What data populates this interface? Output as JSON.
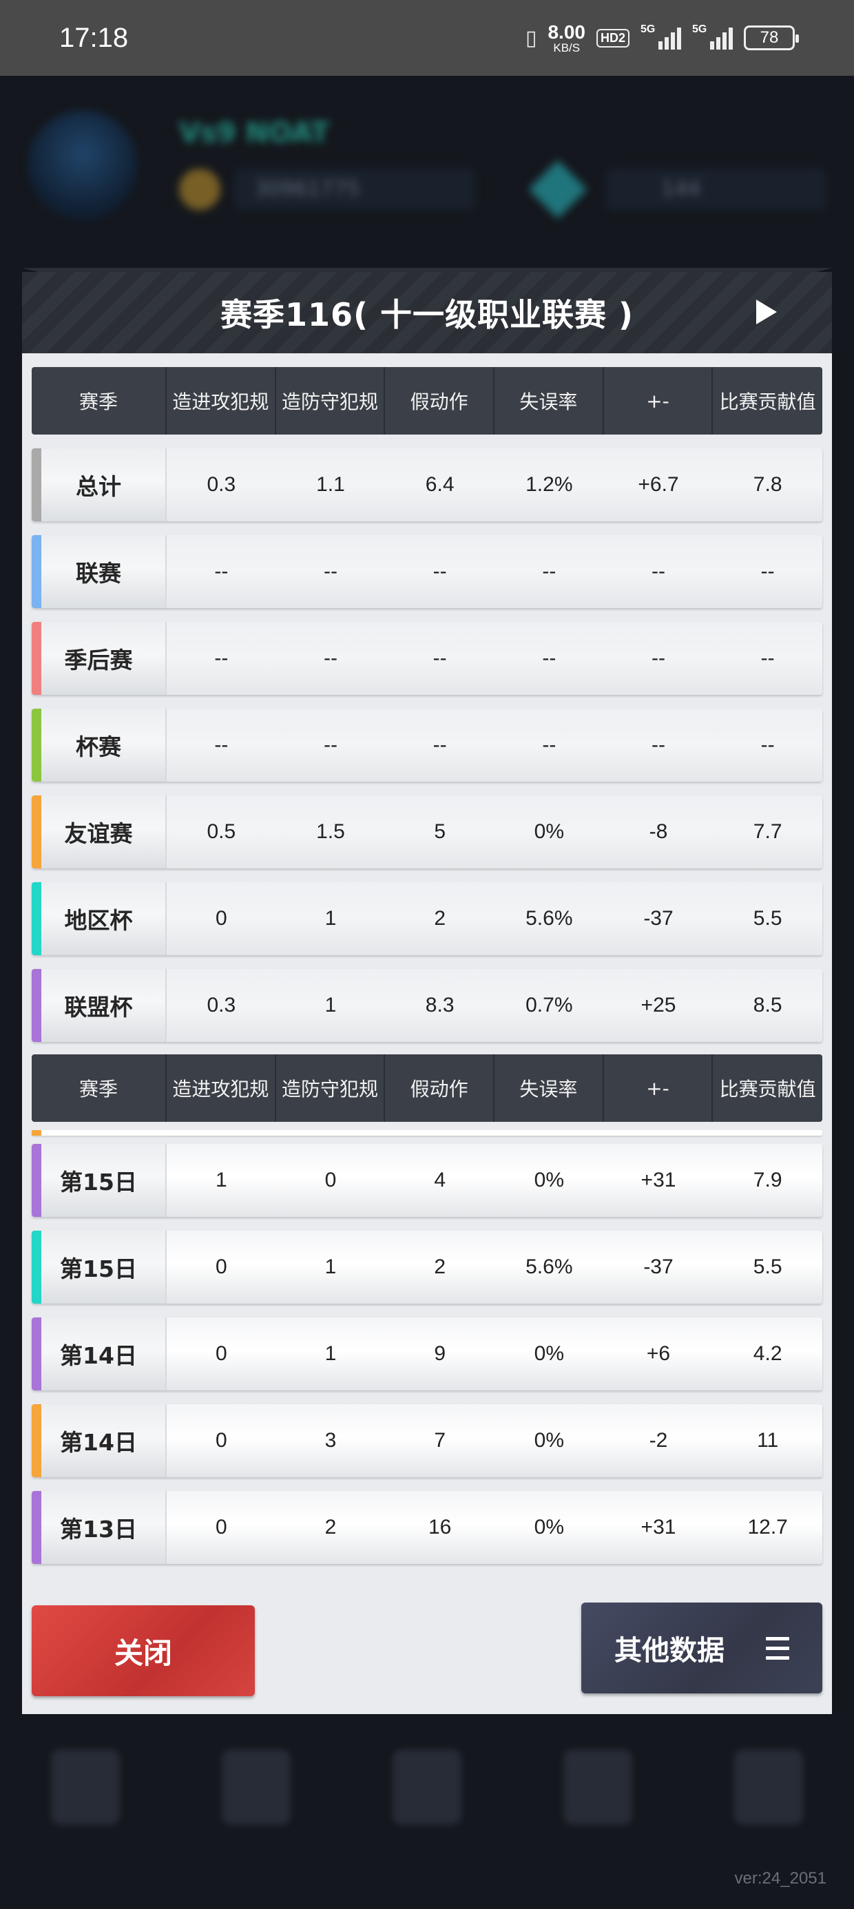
{
  "status_bar": {
    "time": "17:18",
    "net_speed": "8.00",
    "net_unit": "KB/S",
    "hd": "HD2",
    "signal1": "5G",
    "signal2": "5G",
    "battery": "78"
  },
  "modal": {
    "title": "赛季116( 十一级职业联赛 )",
    "header_columns": [
      "赛季",
      "造进攻犯规",
      "造防守犯规",
      "假动作",
      "失误率",
      "+-",
      "比赛贡献值"
    ],
    "summary_rows": [
      {
        "label": "总计",
        "stripe": "#a9a9a9",
        "values": [
          "0.3",
          "1.1",
          "6.4",
          "1.2%",
          "+6.7",
          "7.8"
        ]
      },
      {
        "label": "联赛",
        "stripe": "#7ab2f2",
        "values": [
          "--",
          "--",
          "--",
          "--",
          "--",
          "--"
        ]
      },
      {
        "label": "季后赛",
        "stripe": "#f08080",
        "values": [
          "--",
          "--",
          "--",
          "--",
          "--",
          "--"
        ]
      },
      {
        "label": "杯赛",
        "stripe": "#8cc63f",
        "values": [
          "--",
          "--",
          "--",
          "--",
          "--",
          "--"
        ]
      },
      {
        "label": "友谊赛",
        "stripe": "#f5a53a",
        "values": [
          "0.5",
          "1.5",
          "5",
          "0%",
          "-8",
          "7.7"
        ]
      },
      {
        "label": "地区杯",
        "stripe": "#22d6c8",
        "values": [
          "0",
          "1",
          "2",
          "5.6%",
          "-37",
          "5.5"
        ]
      },
      {
        "label": "联盟杯",
        "stripe": "#a874d8",
        "values": [
          "0.3",
          "1",
          "8.3",
          "0.7%",
          "+25",
          "8.5"
        ]
      }
    ],
    "game_rows": [
      {
        "label": "第15日",
        "stripe": "#a874d8",
        "values": [
          "1",
          "0",
          "4",
          "0%",
          "+31",
          "7.9"
        ]
      },
      {
        "label": "第15日",
        "stripe": "#22d6c8",
        "values": [
          "0",
          "1",
          "2",
          "5.6%",
          "-37",
          "5.5"
        ]
      },
      {
        "label": "第14日",
        "stripe": "#a874d8",
        "values": [
          "0",
          "1",
          "9",
          "0%",
          "+6",
          "4.2"
        ]
      },
      {
        "label": "第14日",
        "stripe": "#f5a53a",
        "values": [
          "0",
          "3",
          "7",
          "0%",
          "-2",
          "11"
        ]
      },
      {
        "label": "第13日",
        "stripe": "#a874d8",
        "values": [
          "0",
          "2",
          "16",
          "0%",
          "+31",
          "12.7"
        ]
      }
    ],
    "close_label": "关闭",
    "other_label": "其他数据"
  },
  "version": "ver:24_2051"
}
